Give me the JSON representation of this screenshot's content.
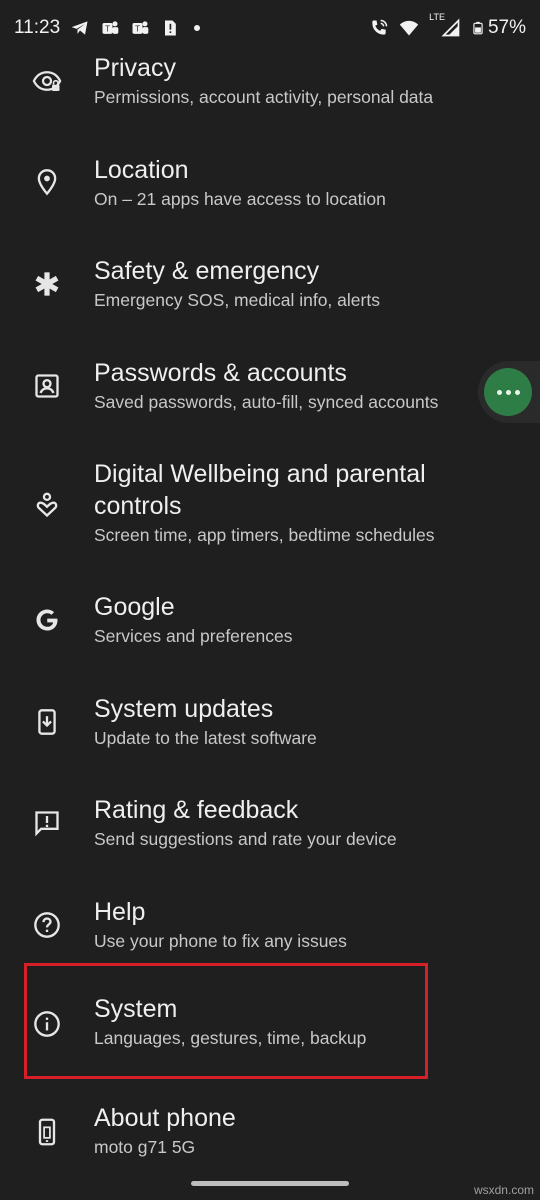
{
  "status_bar": {
    "time": "11:23",
    "network": "LTE",
    "battery": "57%",
    "icons_left": [
      "telegram-icon",
      "teams-icon",
      "teams-icon",
      "notification-icon"
    ],
    "icons_right": [
      "wifi-calling-icon",
      "wifi-icon",
      "signal-icon",
      "battery-icon"
    ]
  },
  "settings": {
    "items": [
      {
        "icon": "privacy-icon",
        "title": "Privacy",
        "subtitle": "Permissions, account activity, personal data"
      },
      {
        "icon": "location-pin-icon",
        "title": "Location",
        "subtitle": "On – 21 apps have access to location"
      },
      {
        "icon": "asterisk-icon",
        "title": "Safety & emergency",
        "subtitle": "Emergency SOS, medical info, alerts"
      },
      {
        "icon": "account-box-icon",
        "title": "Passwords & accounts",
        "subtitle": "Saved passwords, auto-fill, synced accounts"
      },
      {
        "icon": "wellbeing-icon",
        "title": "Digital Wellbeing and parental controls",
        "subtitle": "Screen time, app timers, bedtime schedules"
      },
      {
        "icon": "google-icon",
        "title": "Google",
        "subtitle": "Services and preferences"
      },
      {
        "icon": "system-update-icon",
        "title": "System updates",
        "subtitle": "Update to the latest software"
      },
      {
        "icon": "feedback-icon",
        "title": "Rating & feedback",
        "subtitle": "Send suggestions and rate your device"
      },
      {
        "icon": "help-icon",
        "title": "Help",
        "subtitle": "Use your phone to fix any issues"
      },
      {
        "icon": "info-icon",
        "title": "System",
        "subtitle": "Languages, gestures, time, backup"
      },
      {
        "icon": "phone-icon",
        "title": "About phone",
        "subtitle": "moto g71 5G"
      }
    ]
  },
  "highlight_color": "#d5202a",
  "bubble_color": "#2e7d46",
  "watermark": "wsxdn.com"
}
